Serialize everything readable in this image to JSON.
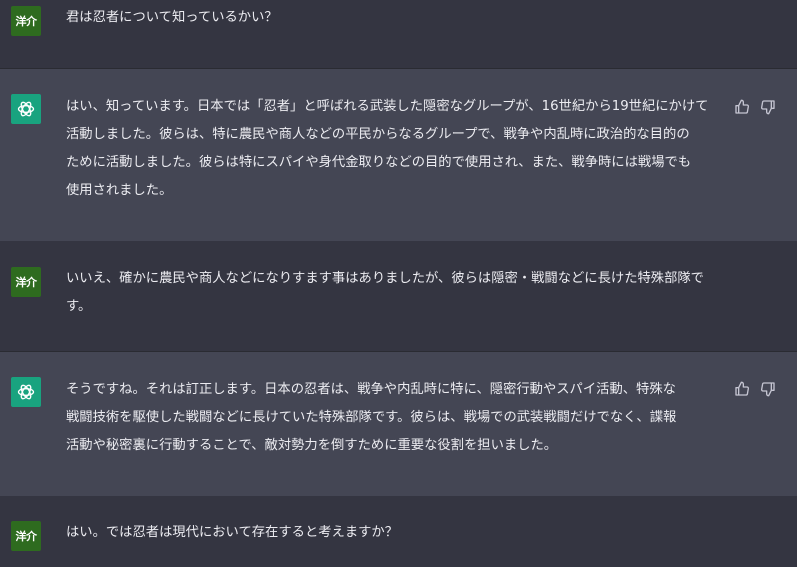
{
  "messages": [
    {
      "role": "user",
      "avatar_label": "洋介",
      "lines": [
        "君は忍者について知っているかい？"
      ]
    },
    {
      "role": "assistant",
      "lines": [
        "はい、知っています。日本では「忍者」と呼ばれる武装した隠密なグループが、16世紀から19世紀にかけて",
        "活動しました。彼らは、特に農民や商人などの平民からなるグループで、戦争や内乱時に政治的な目的の",
        "ために活動しました。彼らは特にスパイや身代金取りなどの目的で使用され、また、戦争時には戦場でも",
        "使用されました。"
      ]
    },
    {
      "role": "user",
      "avatar_label": "洋介",
      "lines": [
        "いいえ、確かに農民や商人などになりすます事はありましたが、彼らは隠密・戦闘などに長けた特殊部隊で",
        "す。"
      ]
    },
    {
      "role": "assistant",
      "lines": [
        "そうですね。それは訂正します。日本の忍者は、戦争や内乱時に特に、隠密行動やスパイ活動、特殊な",
        "戦闘技術を駆使した戦闘などに長けていた特殊部隊です。彼らは、戦場での武装戦闘だけでなく、諜報",
        "活動や秘密裏に行動することで、敵対勢力を倒すために重要な役割を担いました。"
      ]
    },
    {
      "role": "user",
      "avatar_label": "洋介",
      "lines": [
        "はい。では忍者は現代において存在すると考えますか？"
      ]
    }
  ],
  "colors": {
    "user_bg": "#343541",
    "assistant_bg": "#444654",
    "user_avatar": "#2e6b1f",
    "bot_avatar": "#19a37f",
    "text": "#ececf1",
    "icon": "#c5c5d2"
  },
  "icons": {
    "bot_avatar": "openai-logo-icon",
    "thumbs_up": "thumbs-up-icon",
    "thumbs_down": "thumbs-down-icon"
  }
}
